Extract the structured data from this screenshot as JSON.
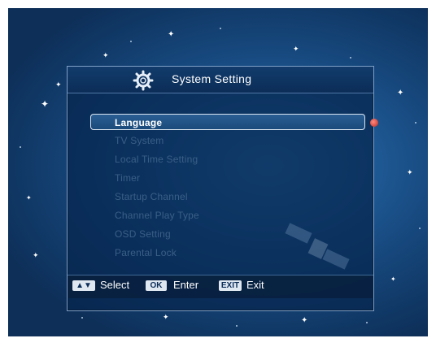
{
  "title": "System Setting",
  "menu": {
    "items": [
      "Language",
      "TV System",
      "Local Time Setting",
      "Timer",
      "Startup Channel",
      "Channel Play Type",
      "OSD Setting",
      "Parental Lock"
    ],
    "selected_index": 0
  },
  "footer": {
    "select_key": "▲▼",
    "select_label": "Select",
    "enter_key": "OK",
    "enter_label": "Enter",
    "exit_key": "EXIT",
    "exit_label": "Exit"
  },
  "colors": {
    "background": "#1f5a95",
    "panel": "#06264e",
    "highlight_border": "#d9e4f0",
    "dim_text": "#3a5f86",
    "indicator": "#c0271c"
  },
  "icons": {
    "title_icon": "gear-icon",
    "selection_marker": "red-dot-icon"
  }
}
